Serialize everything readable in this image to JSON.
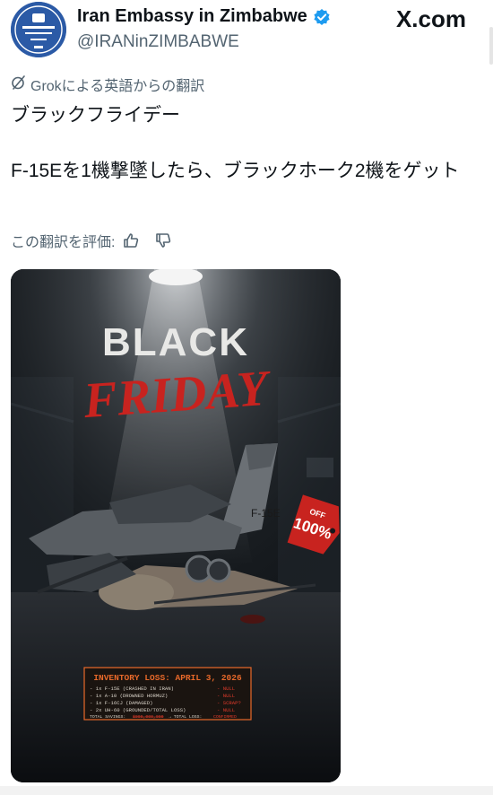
{
  "account": {
    "name": "Iran Embassy in Zimbabwe",
    "handle": "@IRANinZIMBABWE"
  },
  "site": "X.com",
  "translation": {
    "label": "Grokによる英語からの翻訳",
    "rate_label": "この翻訳を評価:"
  },
  "post": {
    "line1": "ブラックフライデー",
    "line2": "F-15Eを1機撃墜したら、ブラックホーク2機をゲット"
  },
  "poster": {
    "title1": "BLACK",
    "title2": "FRIDAY",
    "tail_label": "F-15E",
    "tag_top": "OFF",
    "tag_value": "100%",
    "panel_title": "INVENTORY LOSS: APRIL 3, 2026",
    "rows": [
      {
        "item": "- 1x F-15E (CRASHED IN IRAN)",
        "status": "- NULL"
      },
      {
        "item": "- 1x A-10 (DROWNED HORMUZ)",
        "status": "- NULL"
      },
      {
        "item": "- 1x F-16CJ (DAMAGED)",
        "status": "- SCRAP?"
      },
      {
        "item": "- 2x UH-60 (GROUNDED/TOTAL LOSS)",
        "status": "- NULL"
      }
    ],
    "total_prefix": "TOTAL SAVINGS:",
    "total_struck": "$000,000,000",
    "total_loss": "→ TOTAL LOSS:",
    "total_status": "CONFIRMED"
  },
  "colors": {
    "verified": "#1d9bf0",
    "muted": "#536471",
    "poster_red": "#c8231f",
    "panel_orange": "#e8692a"
  }
}
